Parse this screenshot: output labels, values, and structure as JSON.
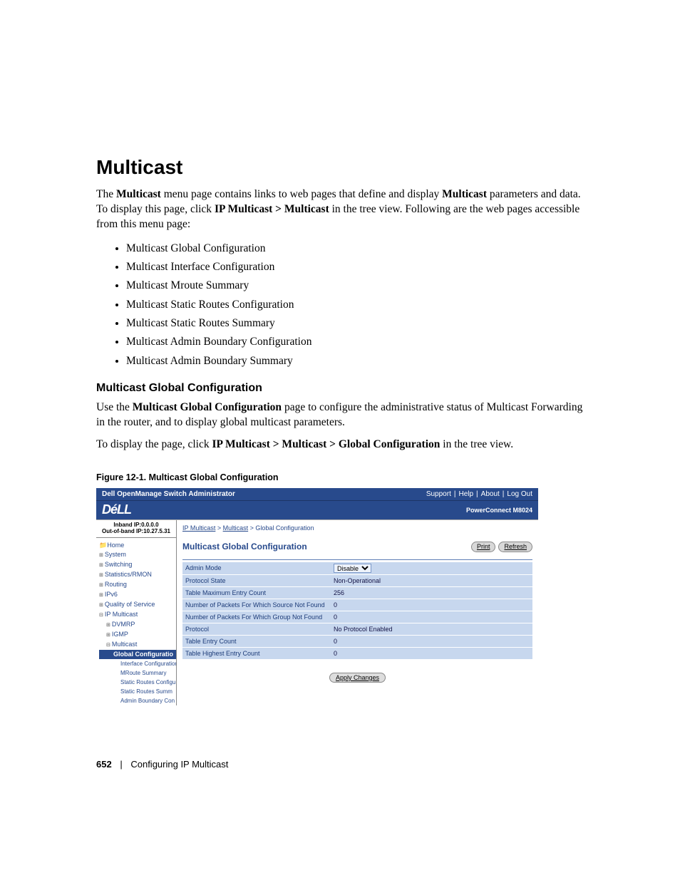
{
  "headings": {
    "h1": "Multicast",
    "h2": "Multicast Global Configuration"
  },
  "body": {
    "intro_1": "The ",
    "intro_bold_1": "Multicast",
    "intro_2": " menu page contains links to web pages that define and display ",
    "intro_bold_2": "Multicast",
    "intro_3": " parameters and data. To display this page, click ",
    "intro_bold_3": "IP Multicast > Multicast",
    "intro_4": " in the tree view. Following are the web pages accessible from this menu page:",
    "sub_intro_1": "Use the ",
    "sub_intro_bold": "Multicast Global Configuration",
    "sub_intro_2": " page to configure the administrative status of Multicast Forwarding in the router, and to display global multicast parameters.",
    "display_1": "To display the page, click ",
    "display_bold": "IP Multicast > Multicast > Global Configuration",
    "display_2": " in the tree view."
  },
  "bullets": [
    "Multicast Global Configuration",
    "Multicast Interface Configuration",
    "Multicast Mroute Summary",
    "Multicast Static Routes Configuration",
    "Multicast Static Routes Summary",
    "Multicast Admin Boundary Configuration",
    "Multicast Admin Boundary Summary"
  ],
  "figure_caption": "Figure 12-1.    Multicast Global Configuration",
  "screenshot": {
    "app_title": "Dell OpenManage Switch Administrator",
    "top_links": {
      "support": "Support",
      "help": "Help",
      "about": "About",
      "logout": "Log Out"
    },
    "logo_text": "DéLL",
    "model": "PowerConnect M8024",
    "ip_line1": "Inband IP:0.0.0.0",
    "ip_line2": "Out-of-band IP:10.27.5.31",
    "tree": {
      "home": "Home",
      "system": "System",
      "switching": "Switching",
      "stats": "Statistics/RMON",
      "routing": "Routing",
      "ipv6": "IPv6",
      "qos": "Quality of Service",
      "ipmc": "IP Multicast",
      "dvmrp": "DVMRP",
      "igmp": "IGMP",
      "mc": "Multicast",
      "items": {
        "global": "Global Configuratio",
        "iface": "Interface Configuration",
        "mroute": "MRoute Summary",
        "srcfg": "Static Routes Configu",
        "srsum": "Static Routes Summ",
        "abcfg": "Admin Boundary Con"
      }
    },
    "breadcrumb": {
      "a": "IP Multicast",
      "b": "Multicast",
      "c": "Global Configuration"
    },
    "panel_title": "Multicast Global Configuration",
    "buttons": {
      "print": "Print",
      "refresh": "Refresh",
      "apply": "Apply Changes"
    },
    "fields": {
      "admin_mode": {
        "label": "Admin Mode",
        "value": "Disable"
      },
      "proto_state": {
        "label": "Protocol State",
        "value": "Non-Operational"
      },
      "max_entry": {
        "label": "Table Maximum Entry Count",
        "value": "256"
      },
      "src_nf": {
        "label": "Number of Packets For Which Source Not Found",
        "value": "0"
      },
      "grp_nf": {
        "label": "Number of Packets For Which Group Not Found",
        "value": "0"
      },
      "protocol": {
        "label": "Protocol",
        "value": "No Protocol Enabled"
      },
      "tec": {
        "label": "Table Entry Count",
        "value": "0"
      },
      "thec": {
        "label": "Table Highest Entry Count",
        "value": "0"
      }
    }
  },
  "footer": {
    "page": "652",
    "chapter": "Configuring IP Multicast"
  }
}
